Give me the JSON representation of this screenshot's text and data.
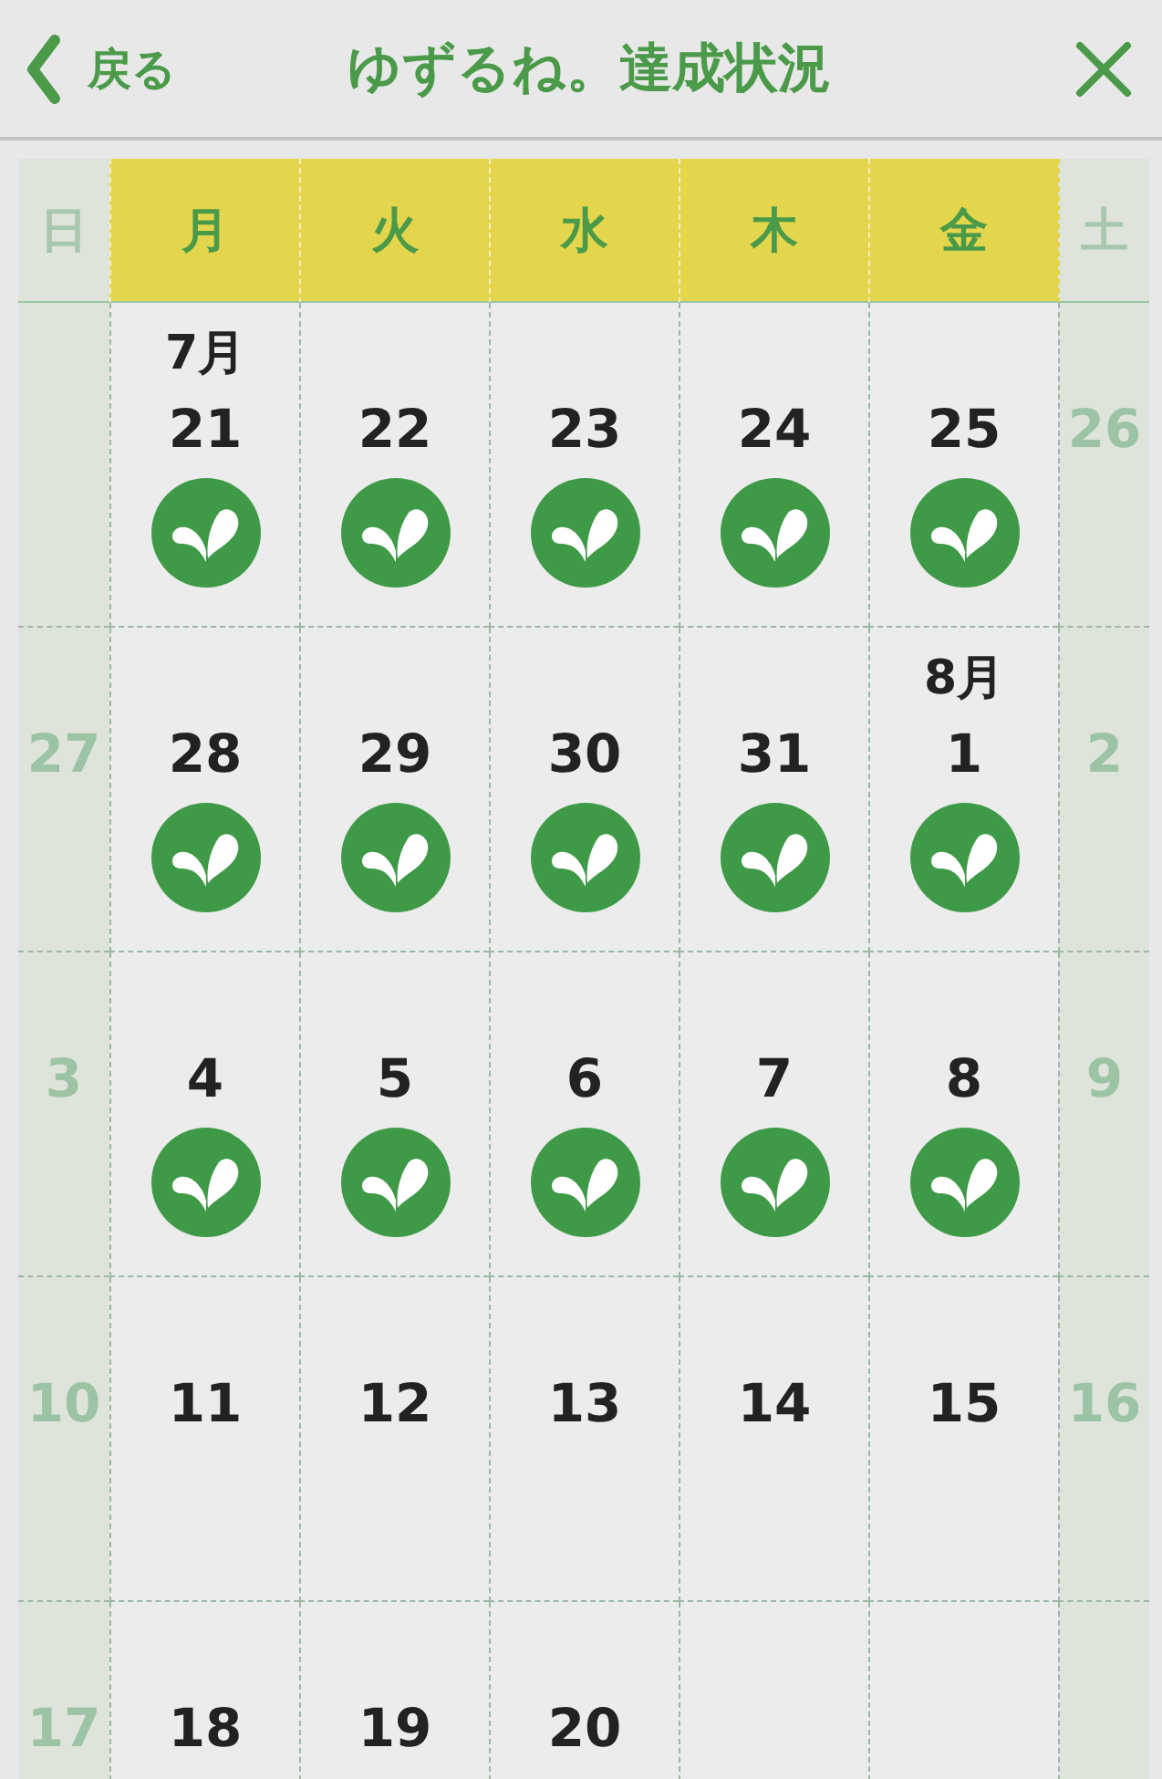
{
  "header": {
    "back_label": "戻る",
    "title": "ゆずるね。達成状況"
  },
  "columns": [
    {
      "label": "日",
      "weekend": true
    },
    {
      "label": "月",
      "weekend": false
    },
    {
      "label": "火",
      "weekend": false
    },
    {
      "label": "水",
      "weekend": false
    },
    {
      "label": "木",
      "weekend": false
    },
    {
      "label": "金",
      "weekend": false
    },
    {
      "label": "土",
      "weekend": true
    }
  ],
  "weeks": [
    [
      {
        "kind": "weekend"
      },
      {
        "kind": "day",
        "month": "7月",
        "date": "21",
        "achieved": true
      },
      {
        "kind": "day",
        "date": "22",
        "achieved": true
      },
      {
        "kind": "day",
        "date": "23",
        "achieved": true
      },
      {
        "kind": "day",
        "date": "24",
        "achieved": true
      },
      {
        "kind": "day",
        "date": "25",
        "achieved": true
      },
      {
        "kind": "weekend",
        "date": "26"
      }
    ],
    [
      {
        "kind": "weekend",
        "date": "27"
      },
      {
        "kind": "day",
        "date": "28",
        "achieved": true
      },
      {
        "kind": "day",
        "date": "29",
        "achieved": true
      },
      {
        "kind": "day",
        "date": "30",
        "achieved": true
      },
      {
        "kind": "day",
        "date": "31",
        "achieved": true
      },
      {
        "kind": "day",
        "month": "8月",
        "date": "1",
        "achieved": true
      },
      {
        "kind": "weekend",
        "date": "2"
      }
    ],
    [
      {
        "kind": "weekend",
        "date": "3"
      },
      {
        "kind": "day",
        "date": "4",
        "achieved": true
      },
      {
        "kind": "day",
        "date": "5",
        "achieved": true
      },
      {
        "kind": "day",
        "date": "6",
        "achieved": true
      },
      {
        "kind": "day",
        "date": "7",
        "achieved": true
      },
      {
        "kind": "day",
        "date": "8",
        "achieved": true
      },
      {
        "kind": "weekend",
        "date": "9"
      }
    ],
    [
      {
        "kind": "weekend",
        "date": "10"
      },
      {
        "kind": "day",
        "date": "11",
        "achieved": false
      },
      {
        "kind": "day",
        "date": "12",
        "achieved": false
      },
      {
        "kind": "day",
        "date": "13",
        "achieved": false
      },
      {
        "kind": "day",
        "date": "14",
        "achieved": false
      },
      {
        "kind": "day",
        "date": "15",
        "achieved": false
      },
      {
        "kind": "weekend",
        "date": "16"
      }
    ],
    [
      {
        "kind": "weekend",
        "date": "17"
      },
      {
        "kind": "day",
        "date": "18",
        "achieved": false
      },
      {
        "kind": "day",
        "date": "19",
        "achieved": false
      },
      {
        "kind": "day",
        "date": "20",
        "achieved": false
      },
      {
        "kind": "day",
        "achieved": false
      },
      {
        "kind": "day",
        "achieved": false
      },
      {
        "kind": "weekend"
      }
    ]
  ]
}
